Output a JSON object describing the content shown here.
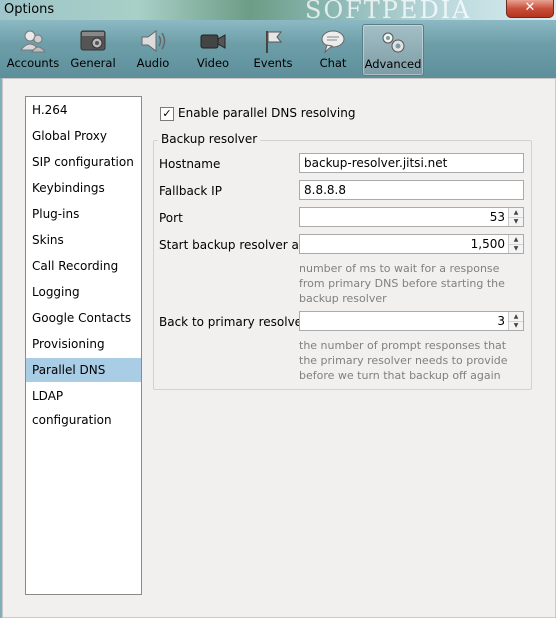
{
  "window": {
    "title": "Options",
    "watermark": "SOFTPEDIA",
    "close_glyph": "✕"
  },
  "toolbar": {
    "items": [
      {
        "label": "Accounts",
        "icon": "accounts-icon"
      },
      {
        "label": "General",
        "icon": "general-icon"
      },
      {
        "label": "Audio",
        "icon": "audio-icon"
      },
      {
        "label": "Video",
        "icon": "video-icon"
      },
      {
        "label": "Events",
        "icon": "events-icon"
      },
      {
        "label": "Chat",
        "icon": "chat-icon"
      },
      {
        "label": "Advanced",
        "icon": "advanced-icon",
        "selected": true
      }
    ]
  },
  "nav": {
    "items": [
      {
        "label": "H.264"
      },
      {
        "label": "Global Proxy"
      },
      {
        "label": "SIP configuration"
      },
      {
        "label": "Keybindings"
      },
      {
        "label": "Plug-ins"
      },
      {
        "label": "Skins"
      },
      {
        "label": "Call Recording"
      },
      {
        "label": "Logging"
      },
      {
        "label": "Google Contacts"
      },
      {
        "label": "Provisioning"
      },
      {
        "label": "Parallel DNS",
        "selected": true
      },
      {
        "label": "LDAP configuration"
      }
    ],
    "selected_color": "#aacde6"
  },
  "panel": {
    "enable_checkbox": {
      "label": "Enable parallel DNS resolving",
      "checked": true,
      "check_glyph": "✓"
    },
    "group_title": "Backup resolver",
    "hostname": {
      "label": "Hostname",
      "value": "backup-resolver.jitsi.net"
    },
    "fallback_ip": {
      "label": "Fallback IP",
      "value": "8.8.8.8"
    },
    "port": {
      "label": "Port",
      "value": "53"
    },
    "start_after": {
      "label": "Start backup resolver after",
      "value": "1,500",
      "hint": "number of ms to wait for a response from primary DNS before starting the backup resolver"
    },
    "back_to_primary": {
      "label": "Back to primary resolver",
      "value": "3",
      "hint": "the number of prompt responses that the primary resolver needs to provide before we turn that backup off again"
    },
    "spin_up": "▲",
    "spin_down": "▼"
  }
}
